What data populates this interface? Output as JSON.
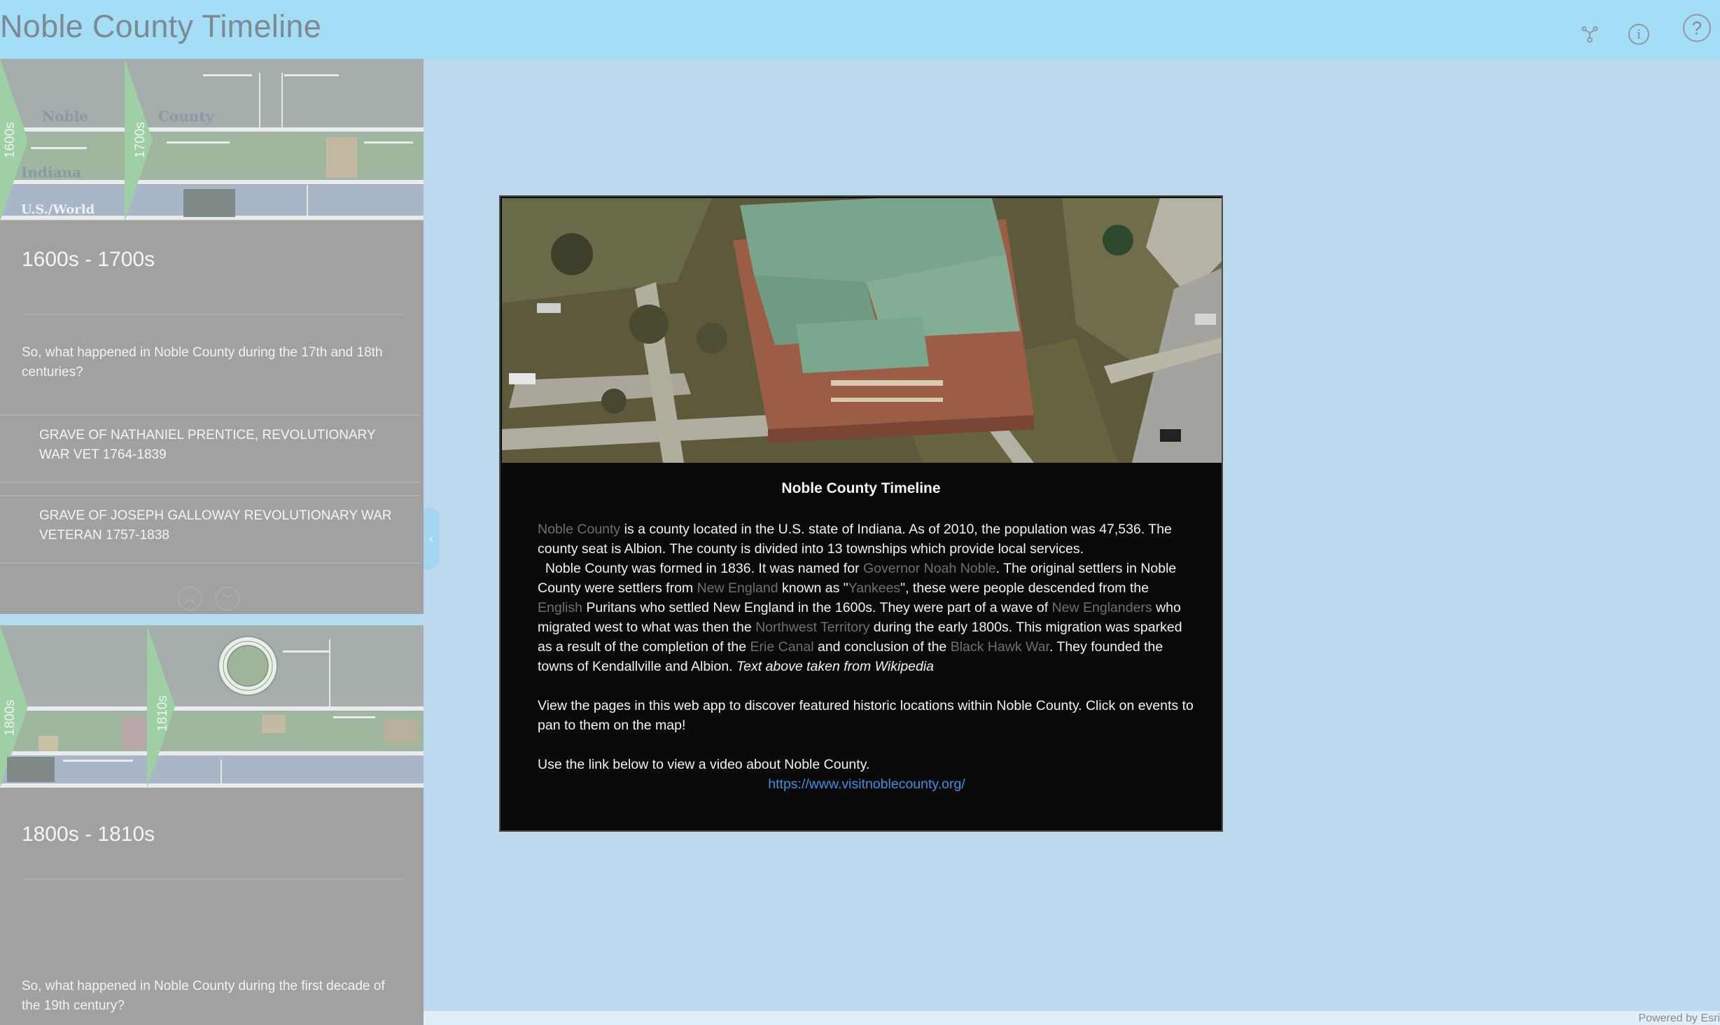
{
  "app": {
    "title": "Noble County Timeline",
    "icons": [
      "share-icon",
      "info-icon",
      "help-icon"
    ]
  },
  "sidebar": {
    "sections": [
      {
        "title": "1600s - 1700s",
        "description": "So, what happened in Noble County during the 17th and 18th centuries?",
        "thumbnail": {
          "era_left": "1600s",
          "era_right": "1700s",
          "row_labels": [
            "Noble",
            "County",
            "Indiana",
            "U.S./World"
          ]
        },
        "items": [
          "GRAVE OF NATHANIEL PRENTICE, REVOLUTIONARY WAR VET 1764-1839",
          "GRAVE OF JOSEPH GALLOWAY REVOLUTIONARY WAR VETERAN 1757-1838"
        ]
      },
      {
        "title": "1800s - 1810s",
        "description": "So, what happened in Noble County during the first decade of the 19th century?",
        "thumbnail": {
          "era_left": "1800s",
          "era_right": "1810s",
          "row_labels": []
        }
      }
    ],
    "scroll": {
      "up": "︿",
      "down": "﹀"
    },
    "collapse_glyph": "‹"
  },
  "panel": {
    "title": "Noble County Timeline",
    "p1": {
      "link1": "Noble County",
      "t1": " is a county located in the U.S. state of Indiana. As of 2010, the population was 47,536. The county seat is Albion. The county is divided into 13 townships which provide local services.",
      "t2": "  Noble County was formed in 1836. It was named for ",
      "link2": "Governor Noah Noble",
      "t3": ". The original settlers in Noble County were settlers from ",
      "link3": "New England",
      "t4": " known as \"",
      "link4": "Yankees",
      "t5": "\", these were people descended from the ",
      "link5": "English",
      "t6": " Puritans who settled New England in the 1600s. They were part of a wave of ",
      "link6": "New Englanders",
      "t7": " who migrated west to what was then the ",
      "link7": "Northwest Territory",
      "t8": " during the early 1800s. This migration was sparked as a result of the completion of the ",
      "link8": "Erie Canal",
      "t9": " and conclusion of the ",
      "link9": "Black Hawk War",
      "t10": ". They founded the towns of Kendallville and Albion. ",
      "italic": "Text above taken from Wikipedia"
    },
    "p2": "View the pages in this web app to discover featured historic locations within Noble County. Click on events to pan to them on the map!",
    "p3": "Use the link below to view a video about Noble County.",
    "url": "https://www.visitnoblecounty.org/"
  },
  "footer": {
    "credit": "Powered by Esri"
  }
}
